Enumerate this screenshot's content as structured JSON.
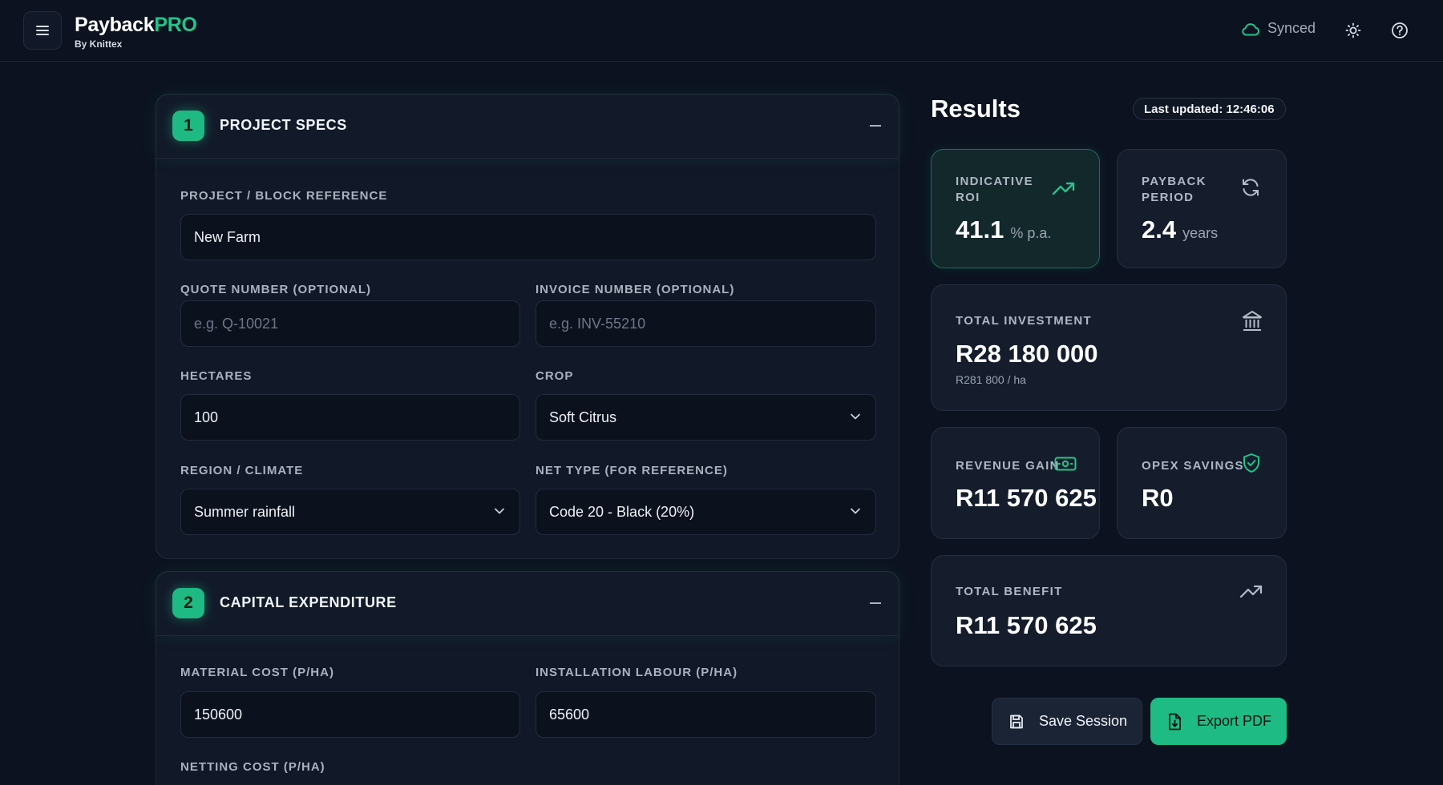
{
  "header": {
    "brand_main": "Payback",
    "brand_accent": "PRO",
    "brand_sub": "By Knittex",
    "sync_status": "Synced",
    "icons": [
      "menu-icon",
      "cloud-icon",
      "sun-icon",
      "help-icon"
    ]
  },
  "sections": {
    "specs": {
      "step": "1",
      "title": "PROJECT SPECS",
      "project_ref_label": "PROJECT / BLOCK REFERENCE",
      "project_ref_value": "New Farm",
      "quote_label": "QUOTE NUMBER (OPTIONAL)",
      "quote_placeholder": "e.g. Q-10021",
      "invoice_label": "INVOICE NUMBER (OPTIONAL)",
      "invoice_placeholder": "e.g. INV-55210",
      "hectares_label": "HECTARES",
      "hectares_value": "100",
      "crop_label": "CROP",
      "crop_value": "Soft Citrus",
      "region_label": "REGION / CLIMATE",
      "region_value": "Summer rainfall",
      "net_label": "NET TYPE (FOR REFERENCE)",
      "net_value": "Code 20 - Black (20%)"
    },
    "capex": {
      "step": "2",
      "title": "CAPITAL EXPENDITURE",
      "material_label": "MATERIAL COST (P/HA)",
      "material_value": "150600",
      "labour_label": "INSTALLATION LABOUR (P/HA)",
      "labour_value": "65600",
      "netting_label": "NETTING COST (P/HA)"
    }
  },
  "results": {
    "title": "Results",
    "last_updated": "Last updated: 12:46:06",
    "roi_label_1": "INDICATIVE",
    "roi_label_2": "ROI",
    "roi_value": "41.1",
    "roi_unit": "% p.a.",
    "payback_label_1": "PAYBACK",
    "payback_label_2": "PERIOD",
    "payback_value": "2.4",
    "payback_unit": "years",
    "investment_label": "TOTAL INVESTMENT",
    "investment_value": "R28 180 000",
    "investment_per_ha": "R281 800 / ha",
    "revenue_label": "REVENUE GAIN",
    "revenue_value": "R11 570 625",
    "opex_label": "OPEX SAVINGS",
    "opex_value": "R0",
    "benefit_label": "TOTAL BENEFIT",
    "benefit_value": "R11 570 625",
    "save_label": "Save Session",
    "export_label": "Export PDF",
    "accent_color": "#1fbb84"
  }
}
